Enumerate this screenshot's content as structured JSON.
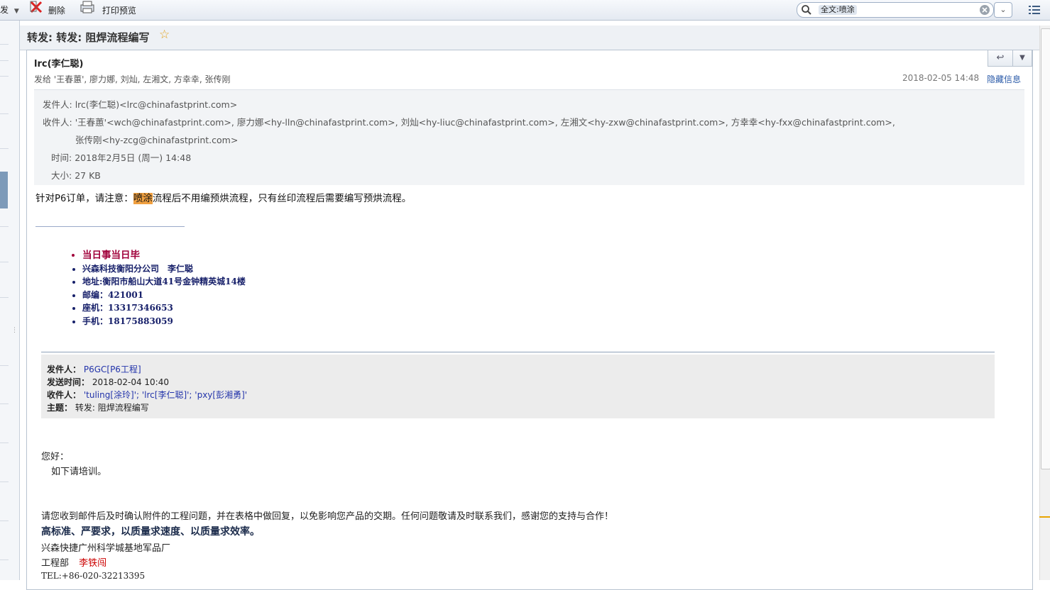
{
  "toolbar": {
    "forward_partial": "发",
    "delete_label": "删除",
    "print_label": "打印预览",
    "search_chip": "全文:喷涂"
  },
  "subject": "转发: 转发: 阻焊流程编写",
  "header": {
    "sender_display": "lrc(李仁聪)",
    "sent_to": "发给 '王春蕙', 廖力娜, 刘灿, 左湘文, 方幸幸, 张传刚",
    "date": "2018-02-05 14:48",
    "hide_info": "隐藏信息",
    "from_label": "发件人:",
    "from_value": "lrc(李仁聪)<lrc@chinafastprint.com>",
    "to_label": "收件人:",
    "to_line1": "'王春蕙'<wch@chinafastprint.com>, 廖力娜<hy-lln@chinafastprint.com>, 刘灿<hy-liuc@chinafastprint.com>, 左湘文<hy-zxw@chinafastprint.com>, 方幸幸<hy-fxx@chinafastprint.com>,",
    "to_line2": "张传刚<hy-zcg@chinafastprint.com>",
    "time_label": "时间:",
    "time_value": "2018年2月5日 (周一) 14:48",
    "size_label": "大小:",
    "size_value": "27 KB"
  },
  "body": {
    "pre": "针对P6订单，请注意：",
    "highlight": "喷涂",
    "post": "流程后不用编预烘流程，只有丝印流程后需要编写预烘流程。"
  },
  "signature": [
    "当日事当日毕",
    "兴森科技衡阳分公司　李仁聪",
    "地址:衡阳市船山大道41号金钟精英城14楼",
    "邮编：421001",
    "座机：13317346653",
    "手机：18175883059"
  ],
  "forwarded": {
    "from_label": "发件人：",
    "from_value": "P6GC[P6工程]",
    "sent_label": "发送时间：",
    "sent_value": "2018-02-04 10:40",
    "to_label": "收件人：",
    "to_value": "'tuling[涂玲]'; 'lrc[李仁聪]'; 'pxy[彭湘勇]'",
    "subject_label": "主题：",
    "subject_value": "转发: 阻焊流程编写"
  },
  "forwarded_body": {
    "greeting": "您好：",
    "line1": "如下请培训。",
    "notice": "请您收到邮件后及时确认附件的工程问题，并在表格中做回复，以免影响您产品的交期。任何问题敬请及时联系我们，感谢您的支持与合作！",
    "slogan": "高标准、严要求，以质量求速度、以质量求效率。",
    "company": "兴森快捷广州科学城基地军品厂",
    "dept": "工程部",
    "person": "李铁闯",
    "tel": "TEL:+86-020-32213395"
  },
  "colors": {
    "highlight": "#f0a040",
    "signature_blue": "#17206a",
    "signature_red": "#a0003a",
    "link_blue": "#2a5aa8"
  }
}
